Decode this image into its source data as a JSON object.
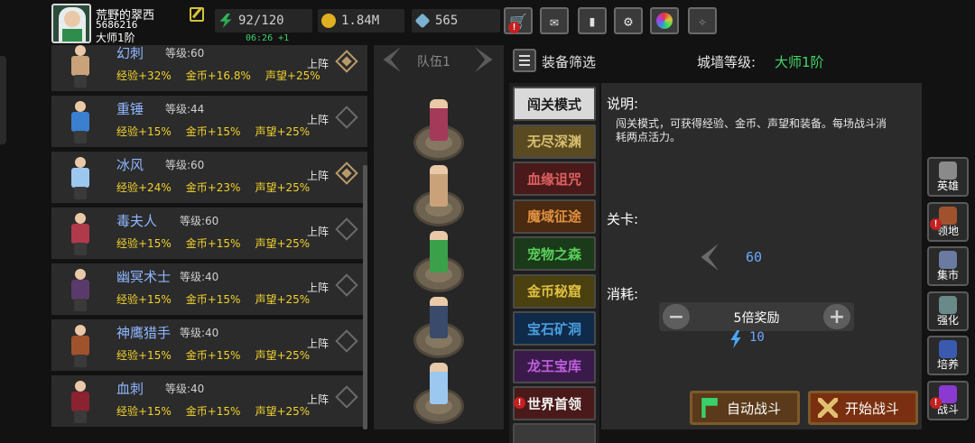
{
  "player": {
    "name": "荒野的翠西",
    "id": "5686216",
    "rank": "大师1阶"
  },
  "resources": {
    "energy": "92/120",
    "gold": "1.84M",
    "gems": "565",
    "timer": "06:26 +1"
  },
  "toolbar": {
    "shop_icon": "cart-icon",
    "mail_icon": "mail-icon",
    "gamepad_icon": "gamepad-icon",
    "settings_icon": "gear-icon",
    "color_icon": "palette-icon",
    "feather_icon": "feather-icon"
  },
  "heroes": [
    {
      "name": "幻刺",
      "level_label": "等级:60",
      "exp": "经验+32%",
      "gold": "金币+16.8%",
      "fame": "声望+25%",
      "deploy": "上阵",
      "deployed": true,
      "color": "#c9a27a"
    },
    {
      "name": "重锤",
      "level_label": "等级:44",
      "exp": "经验+15%",
      "gold": "金币+15%",
      "fame": "声望+25%",
      "deploy": "上阵",
      "deployed": false,
      "color": "#3a7fd0"
    },
    {
      "name": "冰风",
      "level_label": "等级:60",
      "exp": "经验+24%",
      "gold": "金币+23%",
      "fame": "声望+25%",
      "deploy": "上阵",
      "deployed": true,
      "color": "#9cc8f0"
    },
    {
      "name": "毒夫人",
      "level_label": "等级:60",
      "exp": "经验+15%",
      "gold": "金币+15%",
      "fame": "声望+25%",
      "deploy": "上阵",
      "deployed": false,
      "color": "#b03a4a"
    },
    {
      "name": "幽冥术士",
      "level_label": "等级:40",
      "exp": "经验+15%",
      "gold": "金币+15%",
      "fame": "声望+25%",
      "deploy": "上阵",
      "deployed": false,
      "color": "#5a3a6a"
    },
    {
      "name": "神鹰猎手",
      "level_label": "等级:40",
      "exp": "经验+15%",
      "gold": "金币+15%",
      "fame": "声望+25%",
      "deploy": "上阵",
      "deployed": false,
      "color": "#a0522d"
    },
    {
      "name": "血刺",
      "level_label": "等级:40",
      "exp": "经验+15%",
      "gold": "金币+15%",
      "fame": "声望+25%",
      "deploy": "上阵",
      "deployed": false,
      "color": "#8b2230"
    }
  ],
  "team": {
    "label": "队伍1",
    "members": [
      "#a33a5a",
      "#c9a27a",
      "#3aa04a",
      "#3a4a6a",
      "#9cc8f0"
    ]
  },
  "header": {
    "filter_label": "装备筛选",
    "wall_label": "城墙等级:",
    "wall_value": "大师1阶"
  },
  "modes": [
    {
      "label": "闯关模式",
      "bg": "#d9d9d9",
      "fg": "#1a1a1a",
      "badge": false
    },
    {
      "label": "无尽深渊",
      "bg": "#5a4a22",
      "fg": "#d8c070",
      "badge": false
    },
    {
      "label": "血缘诅咒",
      "bg": "#4a1a1a",
      "fg": "#e06060",
      "badge": false
    },
    {
      "label": "魔域征途",
      "bg": "#4a2a10",
      "fg": "#e09040",
      "badge": false
    },
    {
      "label": "宠物之森",
      "bg": "#1a3a1a",
      "fg": "#5ad05a",
      "badge": false
    },
    {
      "label": "金币秘窟",
      "bg": "#4a4010",
      "fg": "#e0c040",
      "badge": false
    },
    {
      "label": "宝石矿洞",
      "bg": "#102a4a",
      "fg": "#4aa0e0",
      "badge": false
    },
    {
      "label": "龙王宝库",
      "bg": "#3a1a4a",
      "fg": "#c060e0",
      "badge": false
    },
    {
      "label": "世界首领",
      "bg": "#4a1a1a",
      "fg": "#f0f0f0",
      "badge": true
    }
  ],
  "detail": {
    "title": "说明:",
    "description": "闯关模式，可获得经验、金币、声望和装备。每场战斗消耗两点活力。",
    "stage_label": "关卡:",
    "stage_value": "60",
    "cost_label": "消耗:",
    "multiplier": "5倍奖励",
    "energy_cost": "10",
    "auto_battle": "自动战斗",
    "start_battle": "开始战斗"
  },
  "side_nav": [
    {
      "label": "英雄",
      "icon": "helmet-icon",
      "color": "#8a8a8a",
      "badge": false
    },
    {
      "label": "领地",
      "icon": "castle-icon",
      "color": "#a0522d",
      "badge": true
    },
    {
      "label": "集市",
      "icon": "market-icon",
      "color": "#6a7aa0",
      "badge": false
    },
    {
      "label": "强化",
      "icon": "anvil-icon",
      "color": "#6a8a8a",
      "badge": false
    },
    {
      "label": "培养",
      "icon": "trophy-icon",
      "color": "#3a5ab0",
      "badge": false
    },
    {
      "label": "战斗",
      "icon": "portal-icon",
      "color": "#8a3ad0",
      "badge": true
    }
  ]
}
